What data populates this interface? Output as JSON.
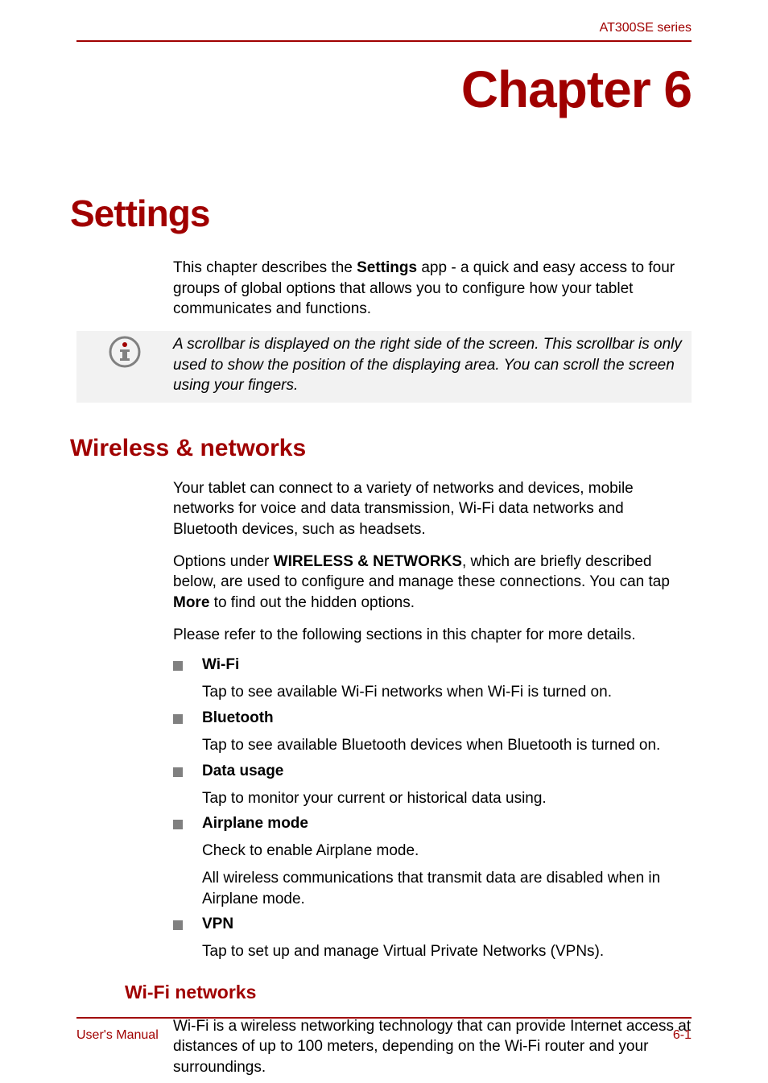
{
  "header": {
    "series": "AT300SE series"
  },
  "chapter": {
    "title": "Chapter 6",
    "name": "Settings"
  },
  "intro": {
    "text_1": "This chapter describes the ",
    "strong_1": "Settings",
    "text_2": " app - a quick and easy access to four groups of global options that allows you to configure how your tablet communicates and functions."
  },
  "note": {
    "text": "A scrollbar is displayed on the right side of the screen. This scrollbar is only used to show the position of the displaying area. You can scroll the screen using your fingers."
  },
  "section1": {
    "title": "Wireless & networks",
    "para1": "Your tablet can connect to a variety of networks and devices, mobile networks for voice and data transmission, Wi-Fi data networks and Bluetooth devices, such as headsets.",
    "para2_a": "Options under ",
    "para2_strong": "WIRELESS & NETWORKS",
    "para2_b": ", which are briefly described below, are used to configure and manage these connections. You can tap ",
    "para2_strong2": "More",
    "para2_c": " to find out the hidden options.",
    "para3": "Please refer to the following sections in this chapter for more details.",
    "items": [
      {
        "label": "Wi-Fi",
        "desc1": "Tap to see available Wi-Fi networks when Wi-Fi is turned on."
      },
      {
        "label": "Bluetooth",
        "desc1": "Tap to see available Bluetooth devices when Bluetooth is turned on."
      },
      {
        "label": "Data usage",
        "desc1": "Tap to monitor your current or historical data using."
      },
      {
        "label": "Airplane mode",
        "desc1": "Check to enable Airplane mode.",
        "desc2": "All wireless communications that transmit data are disabled when in Airplane mode."
      },
      {
        "label": "VPN",
        "desc1": "Tap to set up and manage Virtual Private Networks (VPNs)."
      }
    ]
  },
  "subsection1": {
    "title": "Wi-Fi networks",
    "para1": "Wi-Fi is a wireless networking technology that can provide Internet access at distances of up to 100 meters, depending on the Wi-Fi router and your surroundings."
  },
  "footer": {
    "left": "User's Manual",
    "right": "6-1"
  }
}
